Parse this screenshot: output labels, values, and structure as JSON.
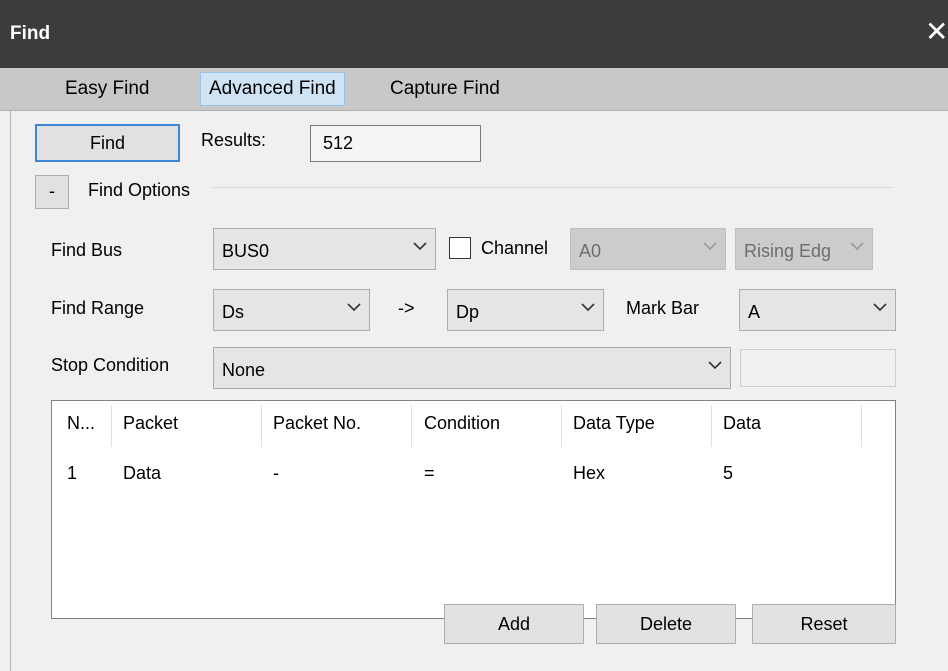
{
  "window": {
    "title": "Find",
    "close_glyph": "✕"
  },
  "tabs": [
    {
      "label": "Easy Find",
      "active": false
    },
    {
      "label": "Advanced Find",
      "active": true
    },
    {
      "label": "Capture Find",
      "active": false
    }
  ],
  "find_button": "Find",
  "results": {
    "label": "Results:",
    "value": "512"
  },
  "find_options": {
    "toggle": "-",
    "label": "Find Options"
  },
  "find_bus": {
    "label": "Find Bus",
    "value": "BUS0"
  },
  "channel": {
    "label": "Channel",
    "checked": false,
    "value": "A0",
    "edge": "Rising Edg"
  },
  "find_range": {
    "label": "Find Range",
    "from": "Ds",
    "arrow": "->",
    "to": "Dp"
  },
  "mark_bar": {
    "label": "Mark Bar",
    "value": "A"
  },
  "stop_condition": {
    "label": "Stop Condition",
    "value": "None",
    "extra": ""
  },
  "table": {
    "columns": [
      "N...",
      "Packet",
      "Packet No.",
      "Condition",
      "Data Type",
      "Data"
    ],
    "rows": [
      [
        "1",
        "Data",
        "-",
        "=",
        "Hex",
        "5"
      ]
    ]
  },
  "actions": {
    "add": "Add",
    "delete": "Delete",
    "reset": "Reset"
  },
  "icons": {
    "dropdown": "chevron-down-icon",
    "close": "close-icon"
  }
}
